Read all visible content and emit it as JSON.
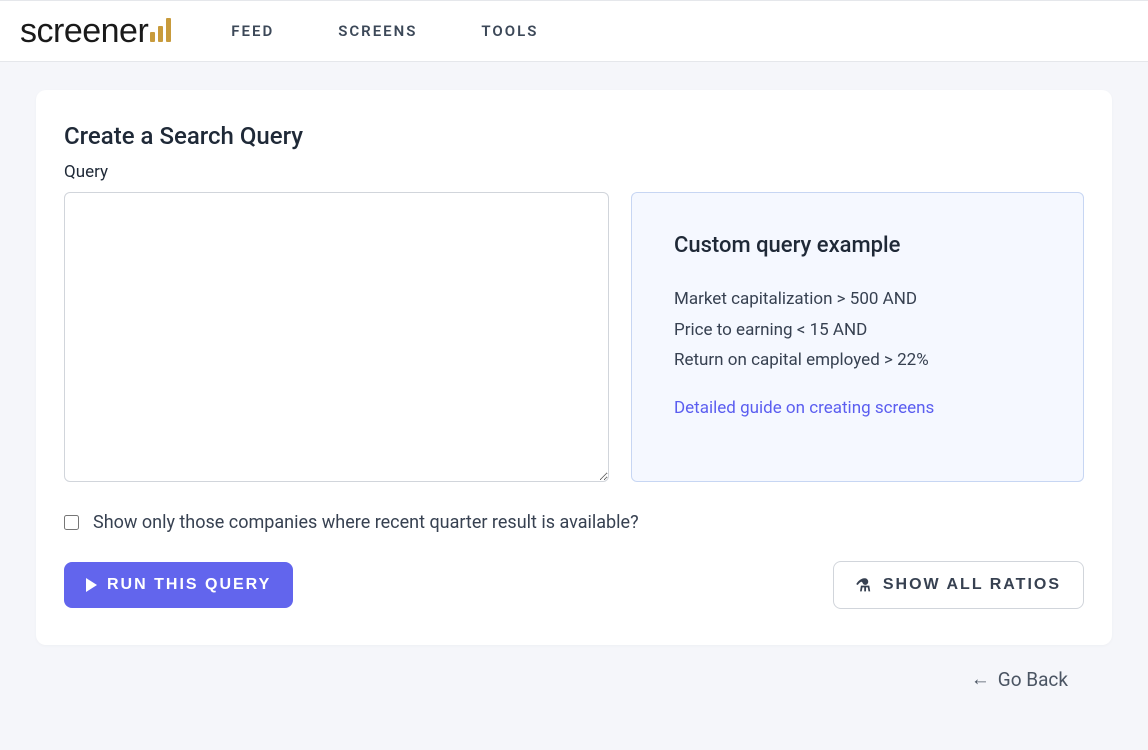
{
  "logo": {
    "text": "screener"
  },
  "nav": {
    "feed": "FEED",
    "screens": "SCREENS",
    "tools": "TOOLS"
  },
  "page": {
    "title": "Create a Search Query",
    "query_label": "Query",
    "query_value": ""
  },
  "example": {
    "title": "Custom query example",
    "body": "Market capitalization > 500 AND\nPrice to earning < 15 AND\nReturn on capital employed > 22%",
    "link_text": "Detailed guide on creating screens"
  },
  "checkbox": {
    "label": "Show only those companies where recent quarter result is available?",
    "checked": false
  },
  "buttons": {
    "run": "RUN THIS QUERY",
    "show_ratios": "SHOW ALL RATIOS"
  },
  "footer": {
    "go_back": "Go Back"
  }
}
